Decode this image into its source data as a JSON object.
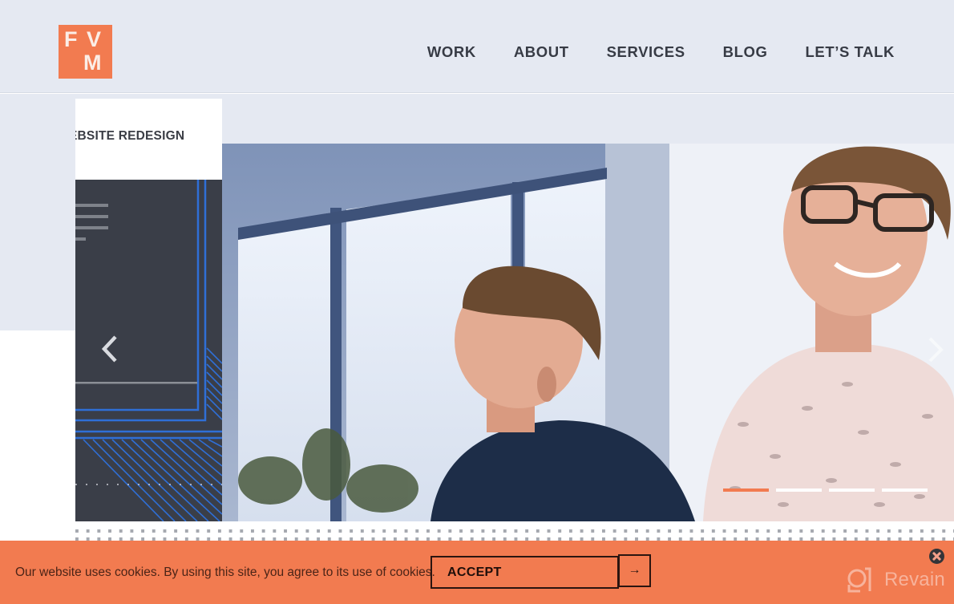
{
  "header": {
    "logo": {
      "letters": [
        "F",
        "V",
        "M"
      ],
      "color": "#f27b50"
    },
    "nav": [
      {
        "label": "WORK"
      },
      {
        "label": "ABOUT"
      },
      {
        "label": "SERVICES"
      },
      {
        "label": "BLOG"
      },
      {
        "label": "LET’S TALK"
      }
    ]
  },
  "slider": {
    "prev_slide_title": "EBSITE REDESIGN",
    "prev_icon": "chevron-left-icon",
    "next_icon": "chevron-right-icon",
    "photo_alt": "Two men in an office looking at a screen",
    "pagination": {
      "count": 4,
      "active_index": 0
    },
    "colors": {
      "active": "#f27b50",
      "inactive": "#ffffff",
      "card_dark": "#3a3e48",
      "accent_blue": "#2f6fd6"
    }
  },
  "cookie_banner": {
    "message": "Our website uses cookies. By using this site, you agree to its use of cookies.",
    "accept_label": "ACCEPT",
    "accept_arrow": "→",
    "close_icon": "close-icon",
    "background": "#f27b50"
  },
  "watermark": {
    "label": "Revain"
  }
}
